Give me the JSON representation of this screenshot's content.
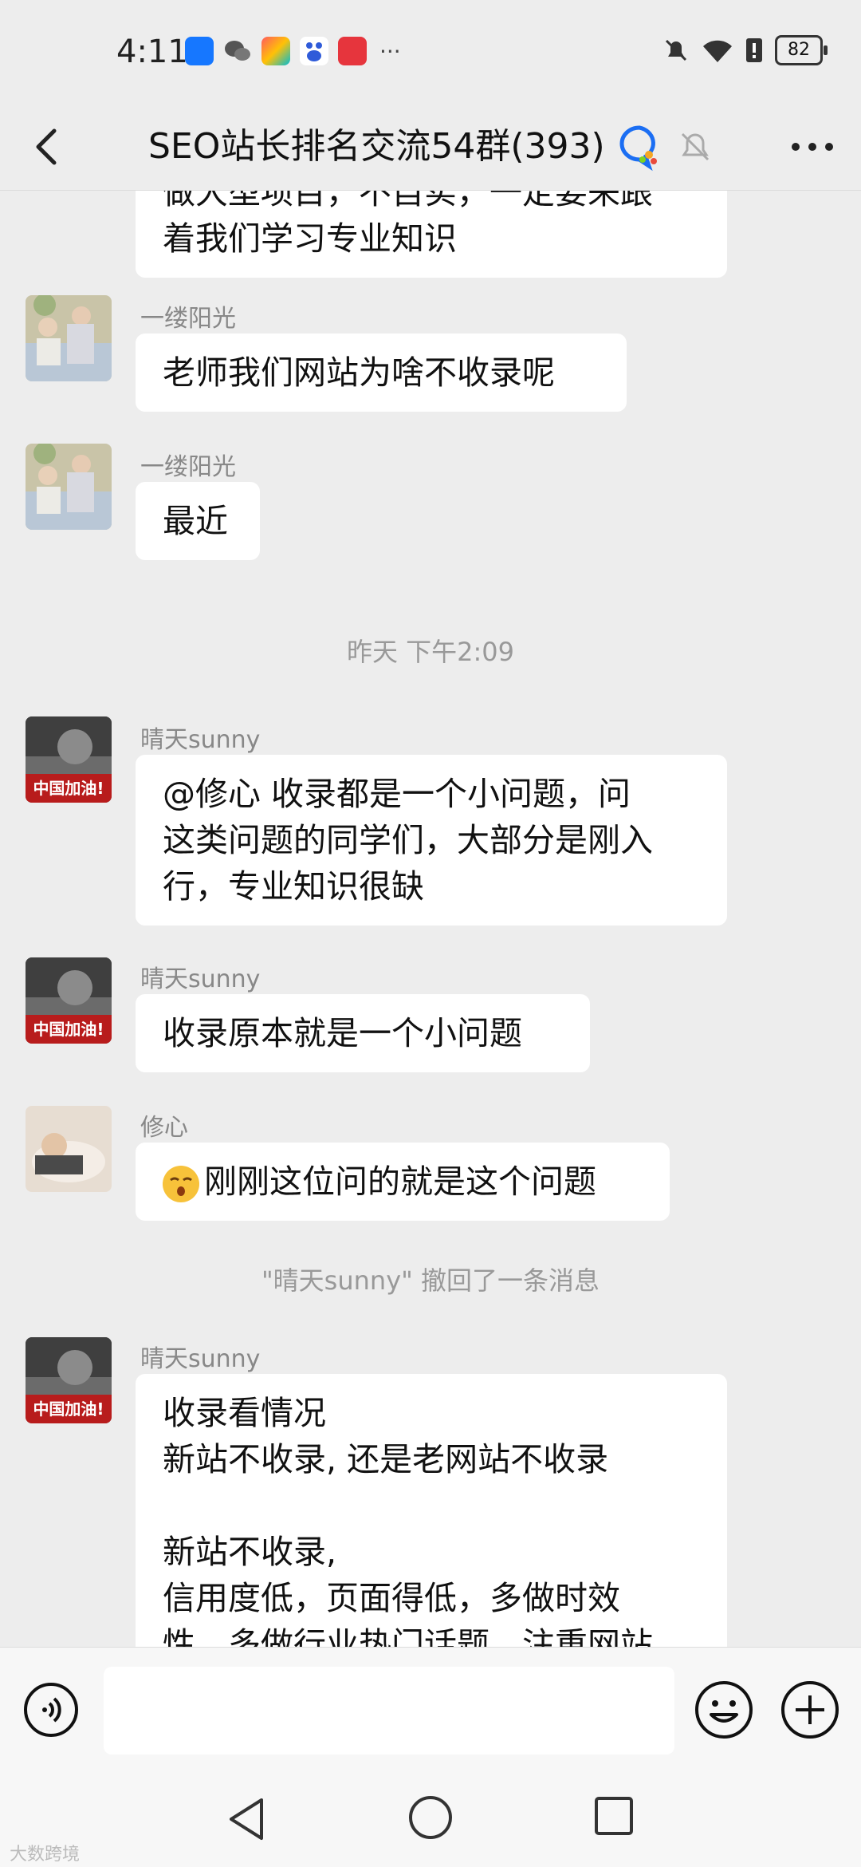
{
  "status": {
    "time": "4:11",
    "more": "···",
    "battery": "82"
  },
  "header": {
    "title": "SEO站长排名交流54群(393)"
  },
  "messages": {
    "m0": {
      "lines": [
        "做大型项目，不自实，一定要来跟",
        "着我们学习专业知识"
      ]
    },
    "m1": {
      "sender": "一缕阳光",
      "text": "老师我们网站为啥不收录呢"
    },
    "m2": {
      "sender": "一缕阳光",
      "text": "最近"
    },
    "t1": "昨天 下午2:09",
    "m3": {
      "sender": "晴天sunny",
      "lines": [
        "@修心  收录都是一个小问题，问",
        "这类问题的同学们，大部分是刚入",
        "行，专业知识很缺"
      ]
    },
    "m4": {
      "sender": "晴天sunny",
      "text": "收录原本就是一个小问题"
    },
    "m5": {
      "sender": "修心",
      "text": "刚刚这位问的就是这个问题"
    },
    "t2": "\"晴天sunny\" 撤回了一条消息",
    "m6": {
      "sender": "晴天sunny",
      "lines": [
        "收录看情况",
        "新站不收录, 还是老网站不收录",
        "",
        "新站不收录,",
        "信用度低，页面得低，多做时效",
        "性，多做行业热门话题，注重网站"
      ]
    }
  },
  "avatar_badge": "中国加油!",
  "input": {
    "placeholder": ""
  },
  "watermark": "大数跨境"
}
